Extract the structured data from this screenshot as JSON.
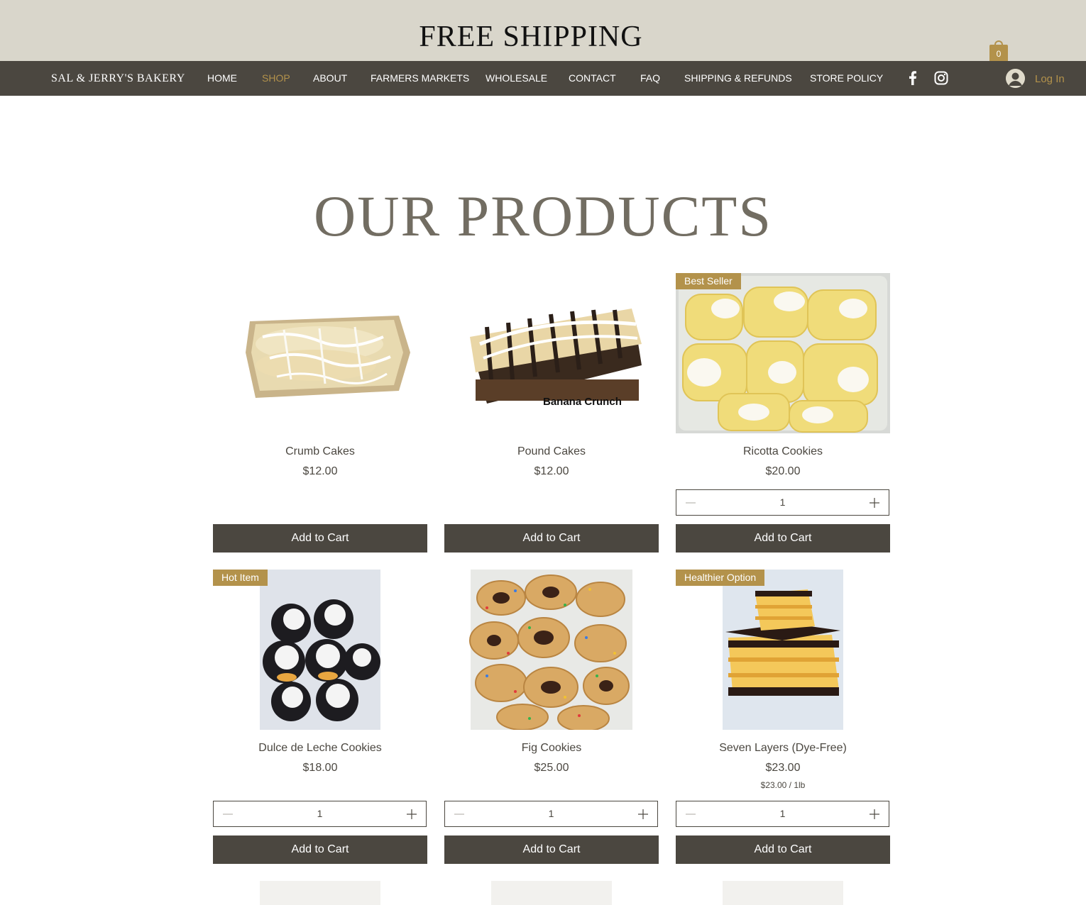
{
  "promo": {
    "text": "FREE SHIPPING"
  },
  "cart": {
    "count": "0",
    "icon": "shopping-bag-icon"
  },
  "brand": {
    "name": "SAL & JERRY'S BAKERY"
  },
  "nav": {
    "items": [
      {
        "label": "HOME"
      },
      {
        "label": "SHOP",
        "active": true
      },
      {
        "label": "ABOUT"
      },
      {
        "label": "FARMERS MARKETS"
      },
      {
        "label": "WHOLESALE"
      },
      {
        "label": "CONTACT"
      },
      {
        "label": "FAQ"
      },
      {
        "label": "SHIPPING & REFUNDS"
      },
      {
        "label": "STORE POLICY"
      }
    ],
    "social": [
      "facebook-icon",
      "instagram-icon"
    ],
    "login_label": "Log In"
  },
  "colors": {
    "accent": "#b3924b",
    "dark": "#4b4740",
    "promo_bg": "#d9d6cb",
    "title": "#726d62"
  },
  "section": {
    "title": "OUR PRODUCTS"
  },
  "products": [
    {
      "name": "Crumb Cakes",
      "price": "$12.00",
      "ribbon": "",
      "quantity": "",
      "add_label": "Add to Cart"
    },
    {
      "name": "Pound Cakes",
      "price": "$12.00",
      "ribbon": "",
      "image_caption": "Banana Crunch",
      "quantity": "",
      "add_label": "Add to Cart"
    },
    {
      "name": "Ricotta Cookies",
      "price": "$20.00",
      "ribbon": "Best Seller",
      "quantity": "1",
      "add_label": "Add to Cart"
    },
    {
      "name": "Dulce de Leche Cookies",
      "price": "$18.00",
      "ribbon": "Hot Item",
      "quantity": "1",
      "add_label": "Add to Cart"
    },
    {
      "name": "Fig Cookies",
      "price": "$25.00",
      "ribbon": "",
      "quantity": "1",
      "add_label": "Add to Cart"
    },
    {
      "name": "Seven Layers (Dye-Free)",
      "price": "$23.00",
      "unit_price": "$23.00 / 1lb",
      "ribbon": "Healthier Option",
      "quantity": "1",
      "add_label": "Add to Cart"
    }
  ]
}
